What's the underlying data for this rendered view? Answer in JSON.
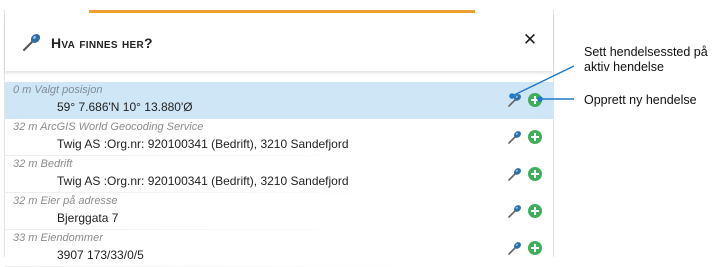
{
  "panel": {
    "title": "Hva finnes her?",
    "accent_color": "#f0a030",
    "selected_row_color": "#cfe6f7",
    "close_symbol": "✕"
  },
  "rows": [
    {
      "head": "0 m Valgt posisjon",
      "value": "59° 7.686'N 10° 13.880'Ø",
      "selected": true
    },
    {
      "head": "32 m ArcGIS World Geocoding Service",
      "value": "Twig AS :Org.nr: 920100341 (Bedrift), 3210 Sandefjord",
      "selected": false
    },
    {
      "head": "32 m Bedrift",
      "value": "Twig AS :Org.nr: 920100341 (Bedrift), 3210 Sandefjord",
      "selected": false
    },
    {
      "head": "32 m Eier på adresse",
      "value": "Bjerggata 7",
      "selected": false
    },
    {
      "head": "33 m Eiendommer",
      "value": "3907 173/33/0/5",
      "selected": false
    }
  ],
  "annotations": {
    "set_location": "Sett hendelsessted på aktiv hendelse",
    "create_incident": "Opprett ny hendelse"
  },
  "icons": {
    "pin": "pin-icon",
    "add": "plus-circle-icon",
    "close": "close-icon"
  },
  "colors": {
    "pin_blue": "#2e6fa8",
    "add_green": "#3fae5a",
    "callout_blue": "#1f78c8"
  }
}
